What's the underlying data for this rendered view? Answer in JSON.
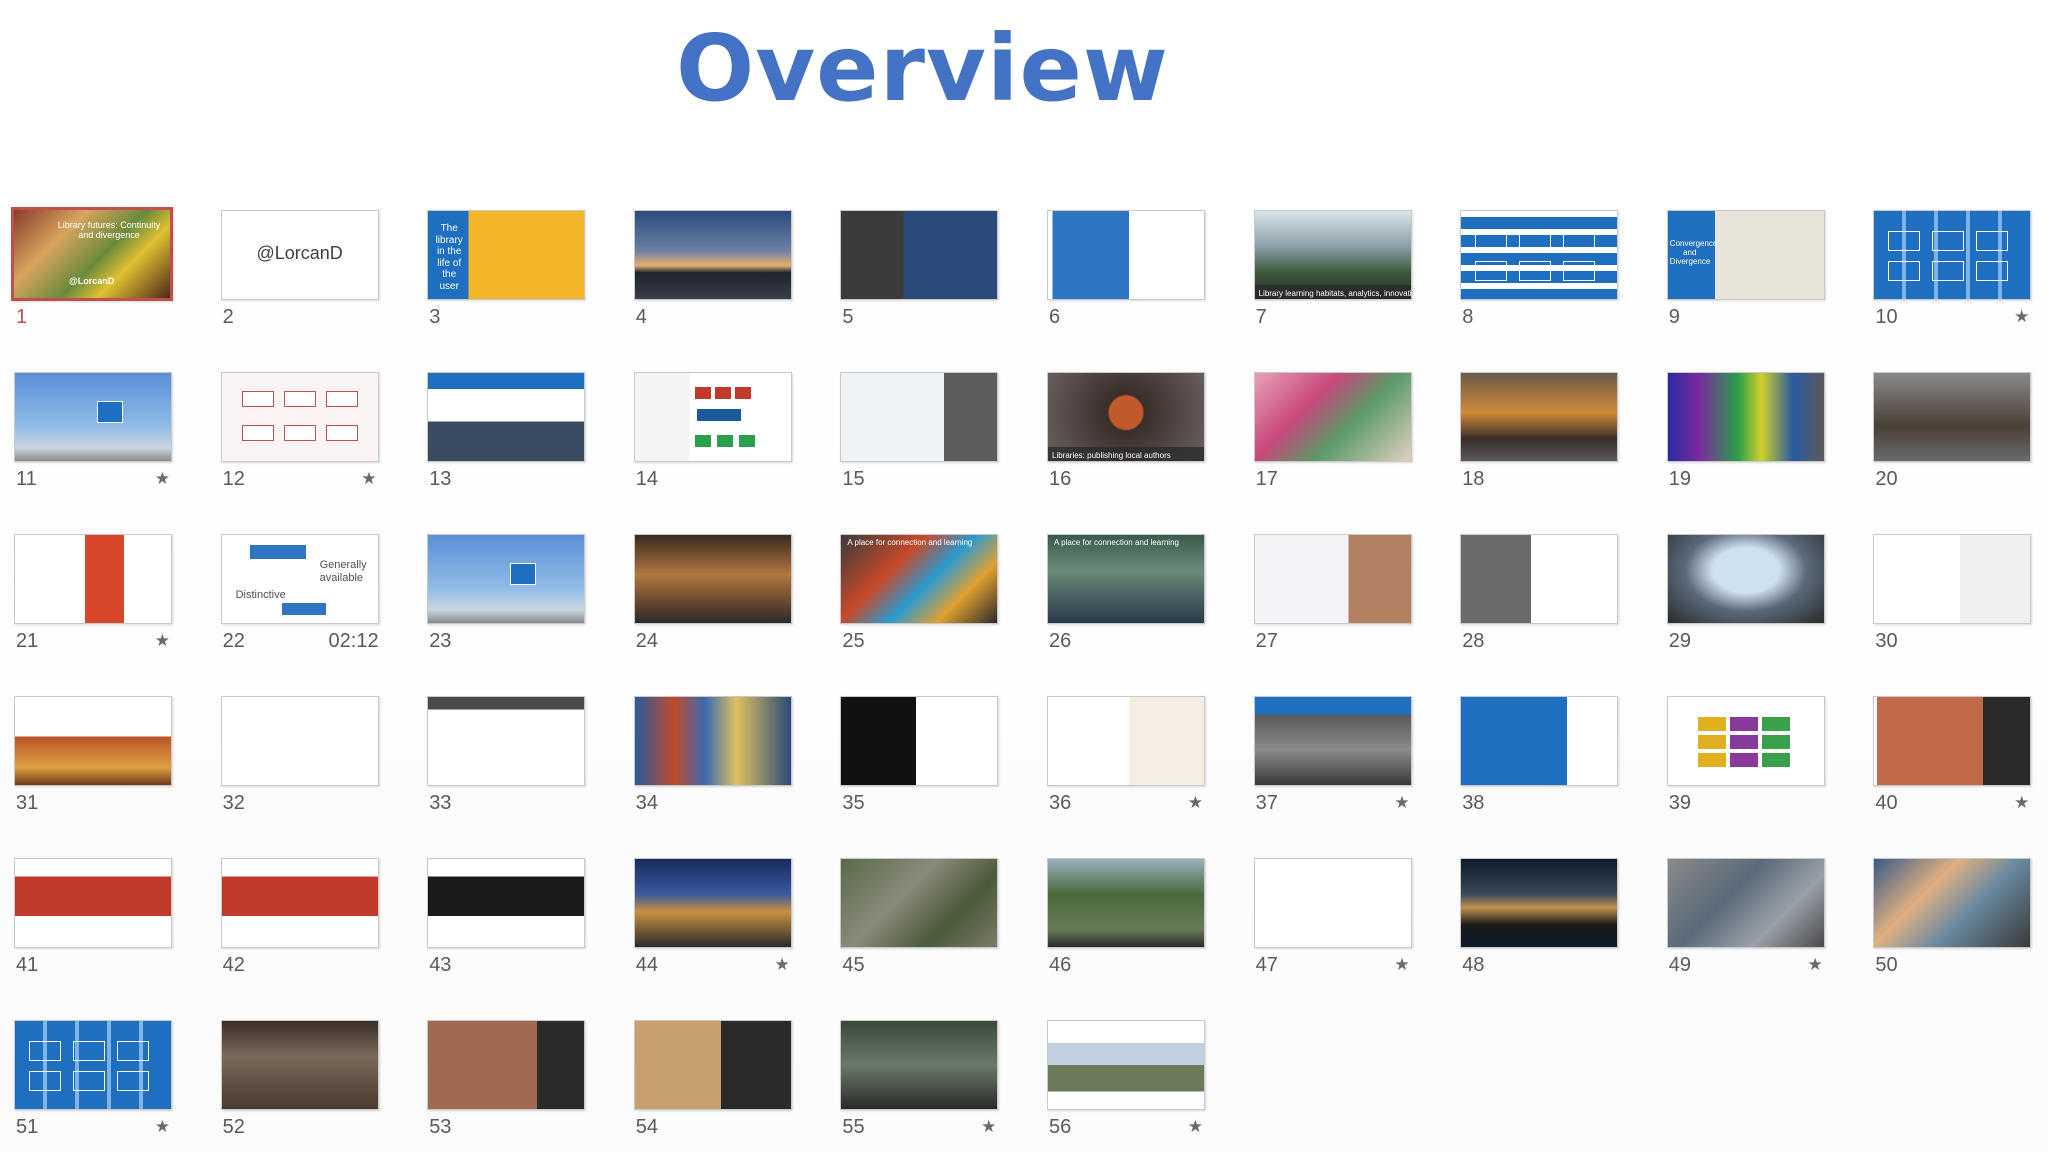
{
  "header": {
    "title": "Overview"
  },
  "colors": {
    "title": "#4472c4",
    "selection": "#c0504d",
    "slide_blue": "#1f6fc1"
  },
  "slides": [
    {
      "num": "1",
      "selected": true,
      "scene": "food",
      "text": "Library futures: Continuity and divergence",
      "sub": "@LorcanD"
    },
    {
      "num": "2",
      "scene": "text-white",
      "text": "@LorcanD"
    },
    {
      "num": "3",
      "scene": "split-yellow",
      "text": "The library in the life of the user"
    },
    {
      "num": "4",
      "scene": "dusk-building"
    },
    {
      "num": "5",
      "scene": "dark-photo-text"
    },
    {
      "num": "6",
      "scene": "blue-box"
    },
    {
      "num": "7",
      "scene": "forest-caption",
      "text": "Library learning habitats, analytics, innovation"
    },
    {
      "num": "8",
      "scene": "blue-grid"
    },
    {
      "num": "9",
      "scene": "map-blue",
      "text": "Convergence and Divergence"
    },
    {
      "num": "10",
      "star": true,
      "scene": "blue-diagram"
    },
    {
      "num": "11",
      "star": true,
      "scene": "sky"
    },
    {
      "num": "12",
      "star": true,
      "scene": "red-flow"
    },
    {
      "num": "13",
      "scene": "text-photo"
    },
    {
      "num": "14",
      "scene": "org-chart"
    },
    {
      "num": "15",
      "scene": "doc-gray"
    },
    {
      "num": "16",
      "scene": "person",
      "text": "Libraries: publishing local authors"
    },
    {
      "num": "17",
      "scene": "pink-collage"
    },
    {
      "num": "18",
      "scene": "lounge"
    },
    {
      "num": "19",
      "scene": "rainbow"
    },
    {
      "num": "20",
      "scene": "cafe"
    },
    {
      "num": "21",
      "star": true,
      "scene": "red-web"
    },
    {
      "num": "22",
      "meta": "02:12",
      "scene": "words",
      "t1": "Distinctive",
      "t2": "Generally available"
    },
    {
      "num": "23",
      "scene": "sky"
    },
    {
      "num": "24",
      "scene": "wood-hall"
    },
    {
      "num": "25",
      "scene": "colorful-room",
      "text": "A place for connection and learning"
    },
    {
      "num": "26",
      "scene": "study-room",
      "text": "A place for connection and learning"
    },
    {
      "num": "27",
      "scene": "web-page"
    },
    {
      "num": "28",
      "scene": "gray-text-photo"
    },
    {
      "num": "29",
      "scene": "oval-roof"
    },
    {
      "num": "30",
      "scene": "doc-list"
    },
    {
      "num": "31",
      "scene": "leaves-web"
    },
    {
      "num": "32",
      "scene": "white-doc"
    },
    {
      "num": "33",
      "scene": "sketch"
    },
    {
      "num": "34",
      "scene": "shelves"
    },
    {
      "num": "35",
      "scene": "black-lines"
    },
    {
      "num": "36",
      "star": true,
      "scene": "white-doc-map"
    },
    {
      "num": "37",
      "star": true,
      "scene": "atrium"
    },
    {
      "num": "38",
      "scene": "blue-list"
    },
    {
      "num": "39",
      "scene": "color-grid"
    },
    {
      "num": "40",
      "star": true,
      "scene": "monash-people"
    },
    {
      "num": "41",
      "scene": "monash-red"
    },
    {
      "num": "42",
      "scene": "monash-red"
    },
    {
      "num": "43",
      "scene": "monash-green"
    },
    {
      "num": "44",
      "star": true,
      "scene": "night-campus"
    },
    {
      "num": "45",
      "scene": "aerial"
    },
    {
      "num": "46",
      "scene": "trees"
    },
    {
      "num": "47",
      "star": true,
      "scene": "blank"
    },
    {
      "num": "48",
      "scene": "night-strip"
    },
    {
      "num": "49",
      "star": true,
      "scene": "shhh"
    },
    {
      "num": "50",
      "scene": "hands"
    },
    {
      "num": "51",
      "star": true,
      "scene": "blue-diagram"
    },
    {
      "num": "52",
      "scene": "brick"
    },
    {
      "num": "53",
      "scene": "church"
    },
    {
      "num": "54",
      "scene": "poster"
    },
    {
      "num": "55",
      "star": true,
      "scene": "sign"
    },
    {
      "num": "56",
      "star": true,
      "scene": "campus-white"
    }
  ]
}
